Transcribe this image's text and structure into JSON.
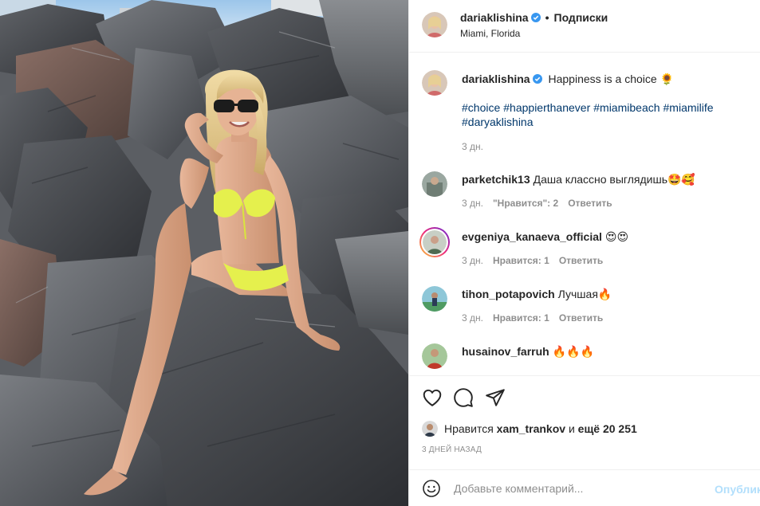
{
  "post": {
    "username": "dariaklishina",
    "verified": true,
    "separator": "•",
    "follow_label": "Подписки",
    "location": "Miami, Florida",
    "image_alt": "Woman in yellow bikini and sunglasses sitting on dark rocks by the sea"
  },
  "caption": {
    "username": "dariaklishina",
    "text": "Happiness is a choice 🌻",
    "hashtags": [
      "#choice",
      "#happierthanever",
      "#miamibeach",
      "#miamilife",
      "#daryaklishina"
    ],
    "time": "3 дн."
  },
  "comments": [
    {
      "username": "parketchik13",
      "text": "Даша классно выглядишь🤩🥰",
      "time": "3 дн.",
      "likes": "\"Нравится\": 2",
      "reply": "Ответить"
    },
    {
      "username": "evgeniya_kanaeva_official",
      "text": "😍😍",
      "time": "3 дн.",
      "likes": "Нравится: 1",
      "reply": "Ответить"
    },
    {
      "username": "tihon_potapovich",
      "text": "Лучшая🔥",
      "time": "3 дн.",
      "likes": "Нравится: 1",
      "reply": "Ответить"
    },
    {
      "username": "husainov_farruh",
      "text": "🔥🔥🔥"
    }
  ],
  "actions": {
    "like": "heart-icon",
    "comment": "comment-icon",
    "share": "share-icon"
  },
  "likes": {
    "prefix": "Нравится",
    "user": "xam_trankov",
    "middle": "и",
    "more": "ещё 20 251"
  },
  "timestamp": "3 дней назад",
  "add_comment": {
    "placeholder": "Добавьте комментарий...",
    "post_label": "Опубликовать"
  },
  "colors": {
    "link": "#00376b",
    "verified": "#3897f0",
    "post_disabled": "#b2dffc",
    "muted": "#8e8e8e"
  }
}
